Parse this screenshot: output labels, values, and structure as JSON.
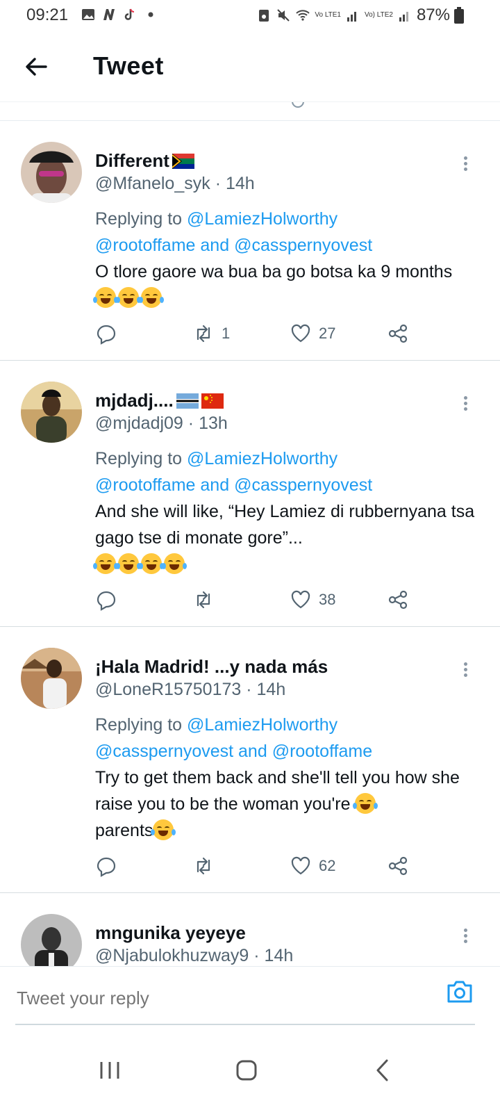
{
  "status_bar": {
    "time": "09:21",
    "net1": "Vo LTE1",
    "net2": "Vo) LTE2",
    "battery_pct": "87%",
    "icons": [
      "gallery-icon",
      "n-icon",
      "tiktok-icon",
      "dot-icon",
      "save-icon",
      "mute-icon",
      "wifi-icon",
      "signal-icon",
      "battery-icon"
    ]
  },
  "header": {
    "title": "Tweet",
    "back_icon": "arrow-left-icon"
  },
  "tweets": [
    {
      "name": "Different",
      "flags": [
        "south-africa-flag"
      ],
      "handle": "@Mfanelo_syk",
      "time": "· 14h",
      "replying_prefix": "Replying to",
      "mentions": [
        "@LamiezHolworthy",
        "@rootoffame",
        "@casspernyovest"
      ],
      "mention_joiner": "and",
      "text": "O tlore gaore wa bua ba go botsa ka 9 months",
      "emoji_count": 3,
      "retweets": "1",
      "likes": "27",
      "avatar_color": "#6e4a3f"
    },
    {
      "name": "mjdadj....",
      "flags": [
        "botswana-flag",
        "china-flag"
      ],
      "handle": "@mjdadj09",
      "time": "· 13h",
      "replying_prefix": "Replying to",
      "mentions": [
        "@LamiezHolworthy",
        "@rootoffame",
        "@casspernyovest"
      ],
      "mention_joiner": "and",
      "text": "And she will like, “Hey Lamiez di rubbernyana tsa gago tse di monate gore”...",
      "emoji_count": 4,
      "retweets": "",
      "likes": "38",
      "avatar_color": "#8a6a3a"
    },
    {
      "name": "¡Hala Madrid! ...y nada más",
      "flags": [],
      "handle": "@LoneR15750173",
      "time": "· 14h",
      "replying_prefix": "Replying to",
      "mentions": [
        "@LamiezHolworthy",
        "@casspernyovest",
        "@rootoffame"
      ],
      "mention_joiner": "and",
      "text_before_emoji": "Try to get them back and she'll tell you how she raise you to be the woman you're",
      "text_after_emoji": "parents",
      "retweets": "",
      "likes": "62",
      "avatar_color": "#a77a48"
    },
    {
      "name": "mngunika yeyeye",
      "flags": [],
      "handle": "@Njabulokhuzway9",
      "time": "· 14h",
      "avatar_color": "#7d7d7d"
    }
  ],
  "reply_bar": {
    "placeholder": "Tweet your reply",
    "camera_icon": "camera-icon"
  },
  "nav_bar": {
    "icons": [
      "recent-apps-icon",
      "home-icon",
      "back-icon"
    ]
  }
}
